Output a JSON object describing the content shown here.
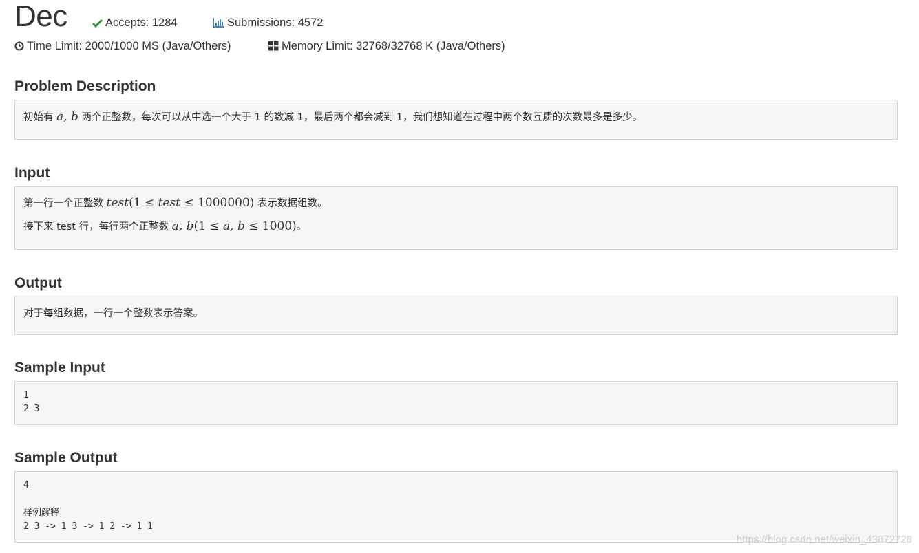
{
  "problem": {
    "title": "Dec",
    "accepts": "Accepts: 1284",
    "submissions": "Submissions: 4572",
    "time_limit": "Time Limit: 2000/1000 MS (Java/Others)",
    "memory_limit": "Memory Limit: 32768/32768 K (Java/Others)"
  },
  "description": {
    "heading": "Problem Description",
    "t1": "初始有 ",
    "m1": "a, b",
    "t2": " 两个正整数，每次可以从中选一个大于 1 的数减 1，最后两个都会减到 1，我们想知道在过程中两个数互质的次数最多是多少。"
  },
  "input": {
    "heading": "Input",
    "l1_t1": "第一行一个正整数 ",
    "l1_m1": "test",
    "l1_n1": "(1 ≤ ",
    "l1_m2": "test",
    "l1_n2": " ≤ 1000000)",
    "l1_t2": " 表示数据组数。",
    "l2_t1": "接下来 test 行，每行两个正整数 ",
    "l2_m1": "a, b",
    "l2_n1": "(1 ≤ ",
    "l2_m2": "a, b",
    "l2_n2": " ≤ 1000)",
    "l2_t2": "。"
  },
  "output": {
    "heading": "Output",
    "text": "对于每组数据，一行一个整数表示答案。"
  },
  "sample_input": {
    "heading": "Sample Input",
    "text": "1\n2 3"
  },
  "sample_output": {
    "heading": "Sample Output",
    "text": "4\n\n样例解释\n2 3 -> 1 3 -> 1 2 -> 1 1"
  },
  "watermark": "https://blog.csdn.net/weixin_43872728",
  "icons": {
    "accepts": "check-icon",
    "submissions": "bar-chart-icon",
    "time": "clock-icon",
    "memory": "grid-icon"
  },
  "colors": {
    "check": "#3c8c3c",
    "chart": "#4a7fb0",
    "box_bg": "#f5f5f5",
    "box_border": "#d4d4d4"
  }
}
